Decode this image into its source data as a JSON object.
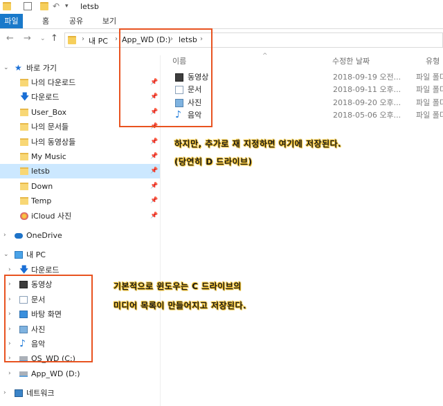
{
  "window": {
    "title": "letsb"
  },
  "ribbon": {
    "tabs": [
      "파일",
      "홈",
      "공유",
      "보기"
    ]
  },
  "address": {
    "segments": [
      "내 PC",
      "App_WD (D:)",
      "letsb"
    ]
  },
  "sidebar": {
    "quick_access_label": "바로 가기",
    "quick_items": [
      {
        "label": "나의 다운로드",
        "icon": "folder-icon"
      },
      {
        "label": "다운로드",
        "icon": "download-icon"
      },
      {
        "label": "User_Box",
        "icon": "folder-icon"
      },
      {
        "label": "나의 문서들",
        "icon": "folder-icon"
      },
      {
        "label": "나의 동영상들",
        "icon": "folder-icon"
      },
      {
        "label": "My Music",
        "icon": "folder-icon"
      },
      {
        "label": "letsb",
        "icon": "folder-icon"
      },
      {
        "label": "Down",
        "icon": "folder-icon"
      },
      {
        "label": "Temp",
        "icon": "folder-icon"
      },
      {
        "label": "iCloud 사진",
        "icon": "icloud-icon"
      }
    ],
    "onedrive_label": "OneDrive",
    "pc_label": "내 PC",
    "pc_items": [
      {
        "label": "다운로드",
        "icon": "download-icon"
      },
      {
        "label": "동영상",
        "icon": "video-icon"
      },
      {
        "label": "문서",
        "icon": "document-icon"
      },
      {
        "label": "바탕 화면",
        "icon": "desktop-icon"
      },
      {
        "label": "사진",
        "icon": "picture-icon"
      },
      {
        "label": "음악",
        "icon": "music-icon"
      },
      {
        "label": "OS_WD (C:)",
        "icon": "drive-icon"
      }
    ],
    "drive_d_label": "App_WD (D:)",
    "network_label": "네트워크"
  },
  "content": {
    "columns": {
      "name": "이름",
      "date": "수정한 날짜",
      "type": "유형"
    },
    "rows": [
      {
        "name": "동영상",
        "date": "2018-09-19 오전...",
        "type": "파일 폴더",
        "icon": "video-icon"
      },
      {
        "name": "문서",
        "date": "2018-09-11 오후...",
        "type": "파일 폴더",
        "icon": "document-icon"
      },
      {
        "name": "사진",
        "date": "2018-09-20 오후...",
        "type": "파일 폴더",
        "icon": "picture-icon"
      },
      {
        "name": "음악",
        "date": "2018-05-06 오후...",
        "type": "파일 폴더",
        "icon": "music-icon"
      }
    ]
  },
  "annotations": {
    "note1_line1": "하지만, 추가로 재 지정하면 여기에 저장된다.",
    "note1_line2": "(당연히 D 드라이브)",
    "note2_line1": "기본적으로 윈도우는 C 드라이브의",
    "note2_line2": "미디어 목록이 만들어지고 저장된다.",
    "highlight_color": "#e8521f"
  }
}
